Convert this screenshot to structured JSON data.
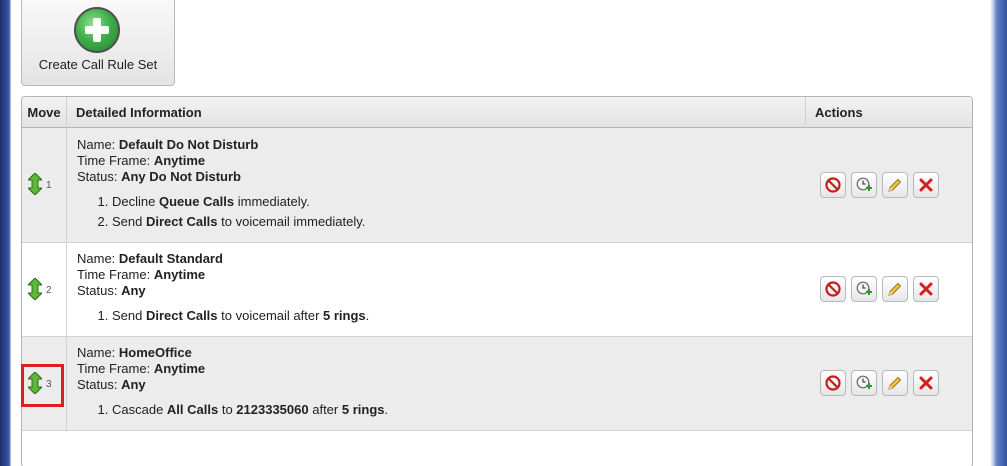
{
  "toolbar": {
    "create_label": "Create Call Rule Set"
  },
  "table": {
    "headers": {
      "move": "Move",
      "detail": "Detailed Information",
      "actions": "Actions"
    },
    "labels": {
      "name": "Name:",
      "timeframe": "Time Frame:",
      "status": "Status:"
    },
    "rows": [
      {
        "position": "1",
        "name": "Default Do Not Disturb",
        "timeframe": "Anytime",
        "status": "Any Do Not Disturb",
        "rules": [
          {
            "a": "Decline ",
            "b": "Queue Calls",
            "c": " immediately.",
            "d": "",
            "e": ""
          },
          {
            "a": "Send ",
            "b": "Direct Calls",
            "c": " to voicemail immediately.",
            "d": "",
            "e": ""
          }
        ]
      },
      {
        "position": "2",
        "name": "Default Standard",
        "timeframe": "Anytime",
        "status": "Any",
        "rules": [
          {
            "a": "Send ",
            "b": "Direct Calls",
            "c": " to voicemail after ",
            "d": "5 rings",
            "e": "."
          }
        ]
      },
      {
        "position": "3",
        "name": "HomeOffice",
        "timeframe": "Anytime",
        "status": "Any",
        "rules": [
          {
            "a": "Cascade ",
            "b": "All Calls",
            "c": " to ",
            "d": "2123335060",
            "e": " after "
          },
          {
            "a": "",
            "b": "",
            "c": "",
            "d": "",
            "e": ""
          }
        ],
        "rule_tail": {
          "f": "5 rings",
          "g": "."
        }
      }
    ]
  },
  "icons": {
    "create": "plus-circle-icon",
    "move": "move-arrows-icon",
    "block": "block-icon",
    "schedule": "schedule-icon",
    "edit": "pencil-icon",
    "delete": "delete-icon"
  },
  "colors": {
    "highlight": "#e01b24",
    "accent_green": "#3fb04a"
  }
}
